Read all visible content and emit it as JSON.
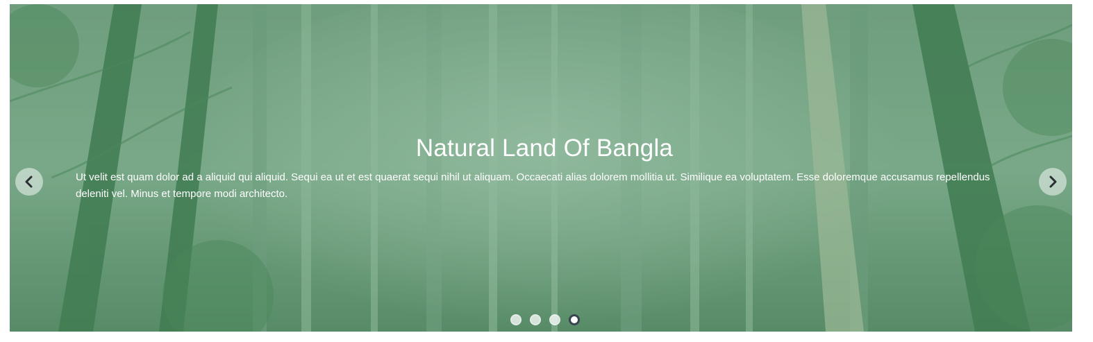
{
  "carousel": {
    "background": "misty green forest",
    "slide": {
      "title": "Natural Land Of Bangla",
      "text": "Ut velit est quam dolor ad a aliquid qui aliquid. Sequi ea ut et est quaerat sequi nihil ut aliquam. Occaecati alias dolorem mollitia ut. Similique ea voluptatem. Esse doloremque accusamus repellendus deleniti vel. Minus et tempore modi architecto."
    },
    "prev_icon": "chevron-left-icon",
    "next_icon": "chevron-right-icon",
    "indicators": [
      {
        "active": false
      },
      {
        "active": false
      },
      {
        "active": false
      },
      {
        "active": true
      }
    ],
    "colors": {
      "overlay": "#46825a",
      "indicator_active_border": "#3a4450",
      "text": "#ffffff"
    }
  }
}
